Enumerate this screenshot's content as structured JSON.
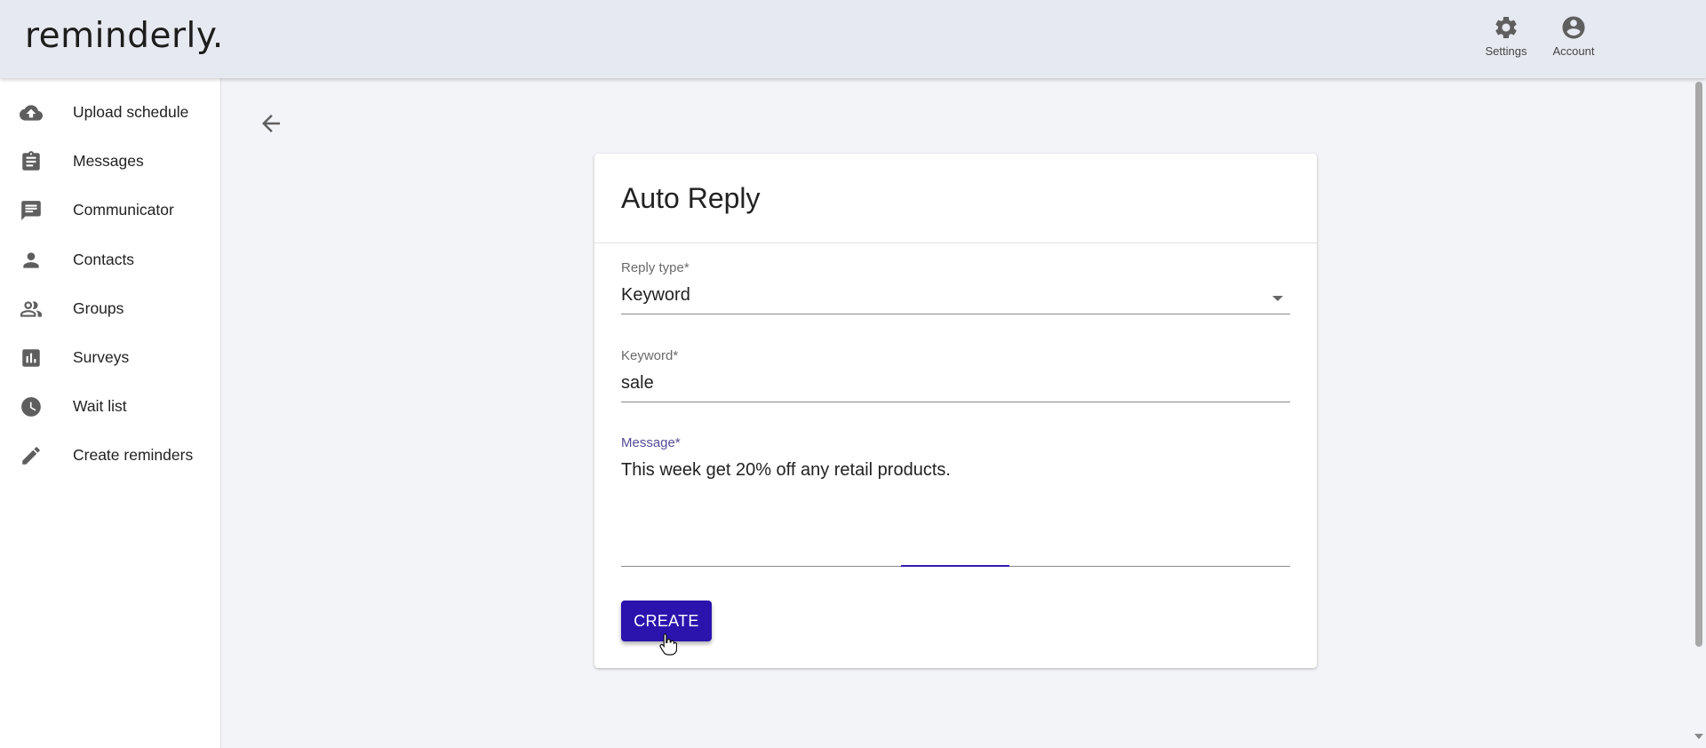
{
  "app": {
    "logo": "reminderly."
  },
  "header": {
    "settings_label": "Settings",
    "account_label": "Account"
  },
  "sidebar": {
    "items": [
      {
        "label": "Upload schedule",
        "icon": "cloud-upload-icon"
      },
      {
        "label": "Messages",
        "icon": "clipboard-icon"
      },
      {
        "label": "Communicator",
        "icon": "chat-icon"
      },
      {
        "label": "Contacts",
        "icon": "person-icon"
      },
      {
        "label": "Groups",
        "icon": "people-icon"
      },
      {
        "label": "Surveys",
        "icon": "bar-chart-icon"
      },
      {
        "label": "Wait list",
        "icon": "clock-icon"
      },
      {
        "label": "Create reminders",
        "icon": "pencil-icon"
      }
    ]
  },
  "form": {
    "title": "Auto Reply",
    "reply_type": {
      "label": "Reply type*",
      "value": "Keyword"
    },
    "keyword": {
      "label": "Keyword*",
      "value": "sale"
    },
    "message": {
      "label": "Message*",
      "value": "This week get 20% off any retail products."
    },
    "create_label": "CREATE"
  },
  "colors": {
    "primary": "#2a14ad",
    "header_bg": "#e7e9f1",
    "page_bg": "#f3f4f8"
  }
}
